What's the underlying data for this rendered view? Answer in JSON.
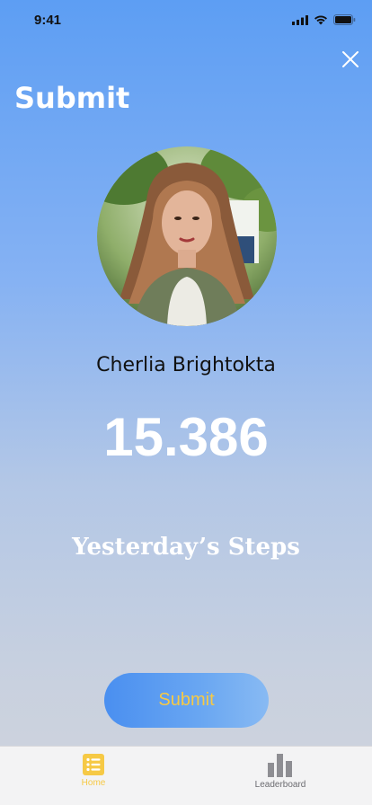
{
  "status_bar": {
    "time": "9:41"
  },
  "header": {
    "title": "Submit"
  },
  "profile": {
    "name": "Cherlia Brightokta",
    "step_count": "15.386",
    "steps_label": "Yesterday’s Steps"
  },
  "actions": {
    "submit_label": "Submit"
  },
  "tab_bar": {
    "tabs": [
      {
        "label": "Home",
        "icon": "list-icon",
        "active": true
      },
      {
        "label": "Leaderboard",
        "icon": "bar-chart-icon",
        "active": false
      }
    ]
  },
  "colors": {
    "accent": "#f6c945",
    "button_start": "#4a8ff0",
    "button_end": "#88baf3",
    "background_top": "#5d9ef3",
    "background_bottom": "#cfd3dc"
  }
}
